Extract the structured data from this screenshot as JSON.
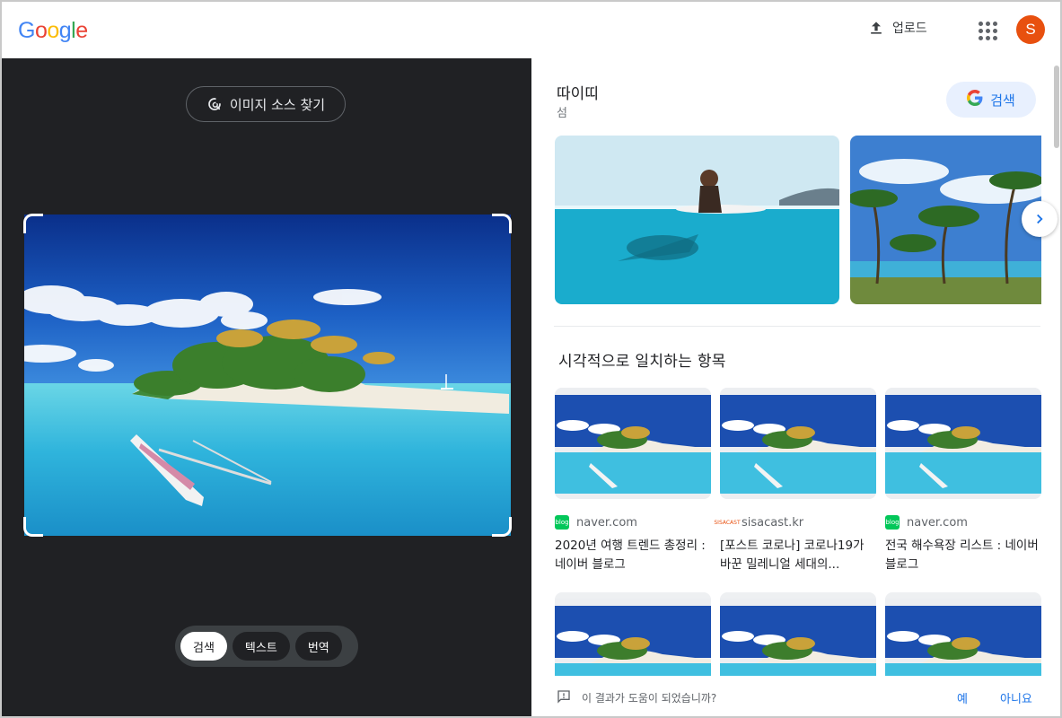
{
  "header": {
    "logo_letters": [
      {
        "ch": "G",
        "color": "#4285F4"
      },
      {
        "ch": "o",
        "color": "#EA4335"
      },
      {
        "ch": "o",
        "color": "#FBBC05"
      },
      {
        "ch": "g",
        "color": "#4285F4"
      },
      {
        "ch": "l",
        "color": "#34A853"
      },
      {
        "ch": "e",
        "color": "#EA4335"
      }
    ],
    "upload_label": "업로드",
    "upload_icon": "upload-icon",
    "apps_icon": "apps-grid-icon",
    "avatar_letter": "S",
    "avatar_color": "#E8500F"
  },
  "left_panel": {
    "find_source_label": "이미지 소스 찾기",
    "find_source_icon": "lens-search-icon",
    "modes": [
      "검색",
      "텍스트",
      "번역"
    ],
    "active_mode": "검색"
  },
  "result": {
    "title": "따이띠",
    "subtitle": "섬",
    "search_button_label": "검색",
    "google_g": "G"
  },
  "visual_matches": {
    "title": "시각적으로 일치하는 항목",
    "cards": [
      {
        "site": "naver.com",
        "favicon": "naver-blog-icon",
        "favicon_text": "blog",
        "title": "2020년 여행 트렌드 총정리 : 네이버 블로그"
      },
      {
        "site": "sisacast.kr",
        "favicon": "sisacast-icon",
        "favicon_text": "SISACAST",
        "title": "[포스트 코로나] 코로나19가 바꾼 밀레니얼 세대의..."
      },
      {
        "site": "naver.com",
        "favicon": "naver-blog-icon",
        "favicon_text": "blog",
        "title": "전국 해수욕장 리스트 : 네이버 블로그"
      }
    ]
  },
  "feedback": {
    "question": "이 결과가 도움이 되었습니까?",
    "yes": "예",
    "no": "아니요",
    "icon": "feedback-icon"
  }
}
